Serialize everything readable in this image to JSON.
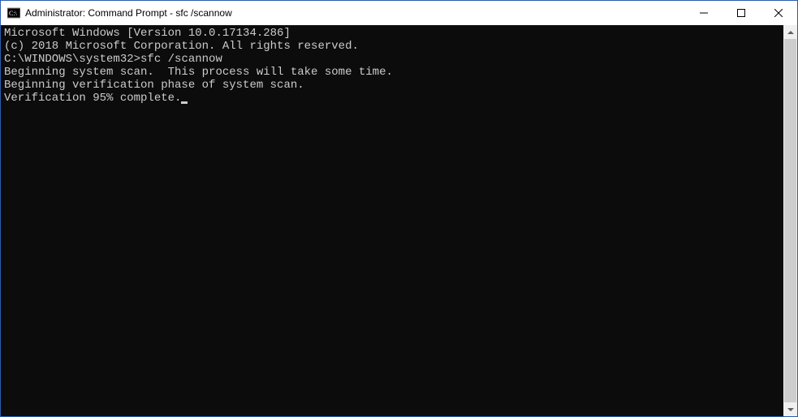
{
  "titlebar": {
    "title": "Administrator: Command Prompt - sfc  /scannow"
  },
  "terminal": {
    "lines": [
      "Microsoft Windows [Version 10.0.17134.286]",
      "(c) 2018 Microsoft Corporation. All rights reserved.",
      "",
      "",
      "Beginning system scan.  This process will take some time.",
      "",
      "Beginning verification phase of system scan.",
      "Verification 95% complete."
    ],
    "prompt": "C:\\WINDOWS\\system32>",
    "command": "sfc /scannow"
  }
}
